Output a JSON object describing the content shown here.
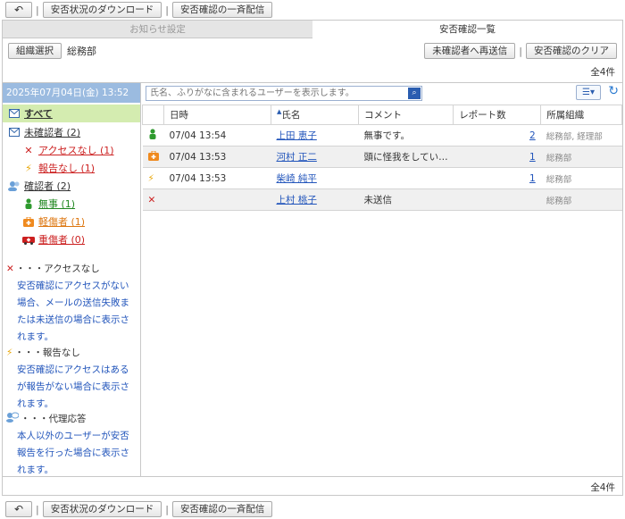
{
  "toolbar": {
    "back_label": "↶",
    "download_label": "安否状況のダウンロード",
    "broadcast_label": "安否確認の一斉配信"
  },
  "tabs": [
    {
      "label": "お知らせ設定",
      "active": false
    },
    {
      "label": "安否確認一覧",
      "active": true
    }
  ],
  "org": {
    "select_label": "組織選択",
    "name": "総務部"
  },
  "actions": {
    "resend_label": "未確認者へ再送信",
    "clear_label": "安否確認のクリア"
  },
  "total": "全4件",
  "sidebar": {
    "datetime": "2025年07月04日(金) 13:52",
    "all": "すべて",
    "unconfirmed": "未確認者 (2)",
    "no_access": "アクセスなし (1)",
    "no_report": "報告なし (1)",
    "confirmed": "確認者 (2)",
    "safe": "無事 (1)",
    "minor": "軽傷者 (1)",
    "severe": "重傷者 (0)"
  },
  "legend": [
    {
      "title": "・・・アクセスなし",
      "desc": "安否確認にアクセスがない場合、メールの送信失敗または未送信の場合に表示されます。"
    },
    {
      "title": "・・・報告なし",
      "desc": "安否確認にアクセスはあるが報告がない場合に表示されます。"
    },
    {
      "title": "・・・代理応答",
      "desc": "本人以外のユーザーが安否報告を行った場合に表示されます。"
    }
  ],
  "search": {
    "placeholder": "氏名、ふりがなに含まれるユーザーを表示します。"
  },
  "table": {
    "headers": {
      "date": "日時",
      "name": "氏名",
      "comment": "コメント",
      "reports": "レポート数",
      "org": "所属組織"
    },
    "rows": [
      {
        "status": "safe",
        "date": "07/04 13:54",
        "name": "上田 恵子",
        "comment": "無事です。",
        "reports": "2",
        "org": "総務部, 経理部"
      },
      {
        "status": "minor",
        "date": "07/04 13:53",
        "name": "河村 正二",
        "comment": "頭に怪我をしてい…",
        "reports": "1",
        "org": "総務部"
      },
      {
        "status": "no_report",
        "date": "07/04 13:53",
        "name": "柴崎 純平",
        "comment": "",
        "reports": "1",
        "org": "総務部"
      },
      {
        "status": "no_access",
        "date": "",
        "name": "上村 桃子",
        "comment": "未送信",
        "reports": "",
        "org": "総務部"
      }
    ]
  },
  "colors": {
    "accent": "#9bbbe0",
    "selected_nav": "#d4ecb0",
    "link": "#2255bb"
  }
}
